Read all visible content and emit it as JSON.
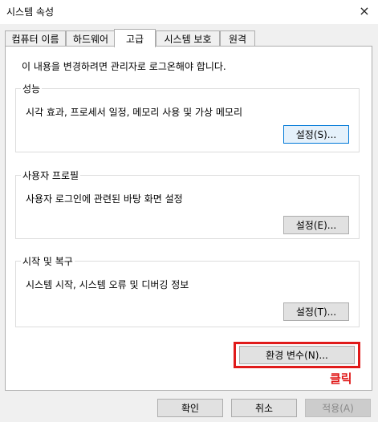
{
  "window": {
    "title": "시스템 속성",
    "close_icon": "×"
  },
  "tabs": [
    {
      "label": "컴퓨터 이름"
    },
    {
      "label": "하드웨어"
    },
    {
      "label": "고급"
    },
    {
      "label": "시스템 보호"
    },
    {
      "label": "원격"
    }
  ],
  "active_tab": "고급",
  "admin_note": "이 내용을 변경하려면 관리자로 로그온해야 합니다.",
  "groups": {
    "performance": {
      "title": "성능",
      "description": "시각 효과, 프로세서 일정, 메모리 사용 및 가상 메모리",
      "button": "설정(S)..."
    },
    "user_profiles": {
      "title": "사용자 프로필",
      "description": "사용자 로그인에 관련된 바탕 화면 설정",
      "button": "설정(E)..."
    },
    "startup_recovery": {
      "title": "시작 및 복구",
      "description": "시스템 시작, 시스템 오류 및 디버깅 정보",
      "button": "설정(T)..."
    }
  },
  "env_button": "환경 변수(N)...",
  "annotation": {
    "text": "클릭",
    "color": "#e01a1a"
  },
  "footer": {
    "ok": "확인",
    "cancel": "취소",
    "apply": "적용(A)"
  },
  "colors": {
    "focus_border": "#0078d7",
    "highlight": "#e01a1a"
  }
}
